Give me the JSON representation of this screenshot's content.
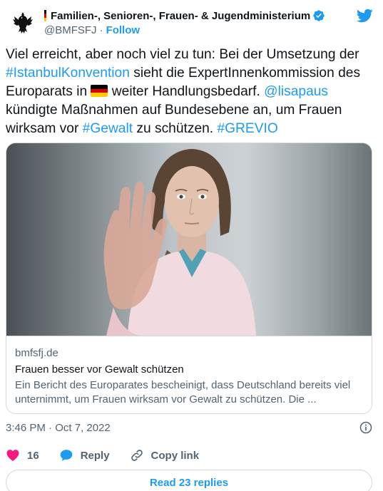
{
  "account": {
    "display_name": "Familien-, Senioren-, Frauen- & Jugendministerium",
    "handle": "@BMFSFJ",
    "separator": "·",
    "follow_label": "Follow",
    "verified_color": "#1d9bf0",
    "flag_colors": [
      "#000000",
      "#dd0000",
      "#ffce00"
    ]
  },
  "tweet": {
    "t1": "Viel erreicht, aber noch viel zu tun: Bei der Umsetzung der ",
    "hashtag1": "#IstanbulKonvention",
    "t2": " sieht die ExpertInnenkommission des Europarats in ",
    "flag_emoji": "germany-flag",
    "t3": " weiter Handlungsbedarf. ",
    "mention": "@lisapaus",
    "t4": " kündigte Maßnahmen auf Bundesebene an, um Frauen wirksam vor ",
    "hashtag2": "#Gewalt",
    "t5": " zu schützen. ",
    "hashtag3": "#GREVIO"
  },
  "card": {
    "domain": "bmfsfj.de",
    "title": "Frauen besser vor Gewalt schützen",
    "description": "Ein Bericht des Europarates bescheinigt, dass Deutschland bereits viel unternimmt, um Frauen wirksam vor Gewalt zu schützen. Die ..."
  },
  "meta": {
    "timestamp": "3:46 PM · Oct 7, 2022"
  },
  "actions": {
    "like_count": "16",
    "reply_label": "Reply",
    "copy_label": "Copy link",
    "like_color": "#f91880",
    "reply_color": "#1d9bf0"
  },
  "replies": {
    "label": "Read 23 replies"
  },
  "icons": [
    "eagle-crest-icon",
    "verified-badge-icon",
    "twitter-bird-icon",
    "info-icon",
    "heart-icon",
    "reply-bubble-icon",
    "link-icon"
  ]
}
